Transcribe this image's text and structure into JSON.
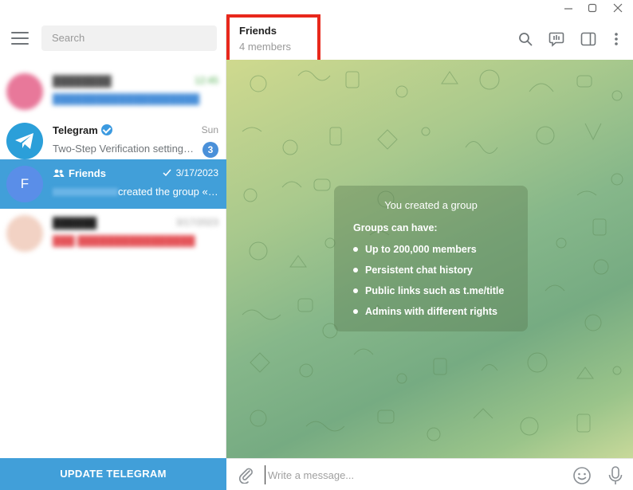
{
  "sidebar": {
    "search_placeholder": "Search",
    "chats": [
      {
        "name": "████████",
        "time": "12:45",
        "preview": "████████████████████"
      },
      {
        "name": "Telegram",
        "time": "Sun",
        "preview": "Two-Step Verification setting…",
        "unread": "3"
      },
      {
        "name": "Friends",
        "time": "3/17/2023",
        "preview": "created the group «Frie…",
        "avatar_letter": "F"
      },
      {
        "name": "██████",
        "time": "3/17/2023",
        "preview": "███ ████████████████"
      }
    ],
    "update_button": "UPDATE TELEGRAM"
  },
  "header": {
    "title": "Friends",
    "subtitle": "4 members"
  },
  "info_box": {
    "title": "You created a group",
    "subtitle": "Groups can have:",
    "items": [
      "Up to 200,000 members",
      "Persistent chat history",
      "Public links such as t.me/title",
      "Admins with different rights"
    ]
  },
  "composer": {
    "placeholder": "Write a message..."
  },
  "colors": {
    "accent": "#419fd9",
    "highlight": "#e8281c",
    "chat_bg": "#a9c98d"
  },
  "icons": [
    "minimize-icon",
    "maximize-icon",
    "close-icon",
    "menu-icon",
    "search-icon",
    "video-chat-icon",
    "sidebar-toggle-icon",
    "more-icon",
    "group-icon",
    "double-check-icon",
    "paperclip-icon",
    "emoji-icon",
    "microphone-icon"
  ]
}
